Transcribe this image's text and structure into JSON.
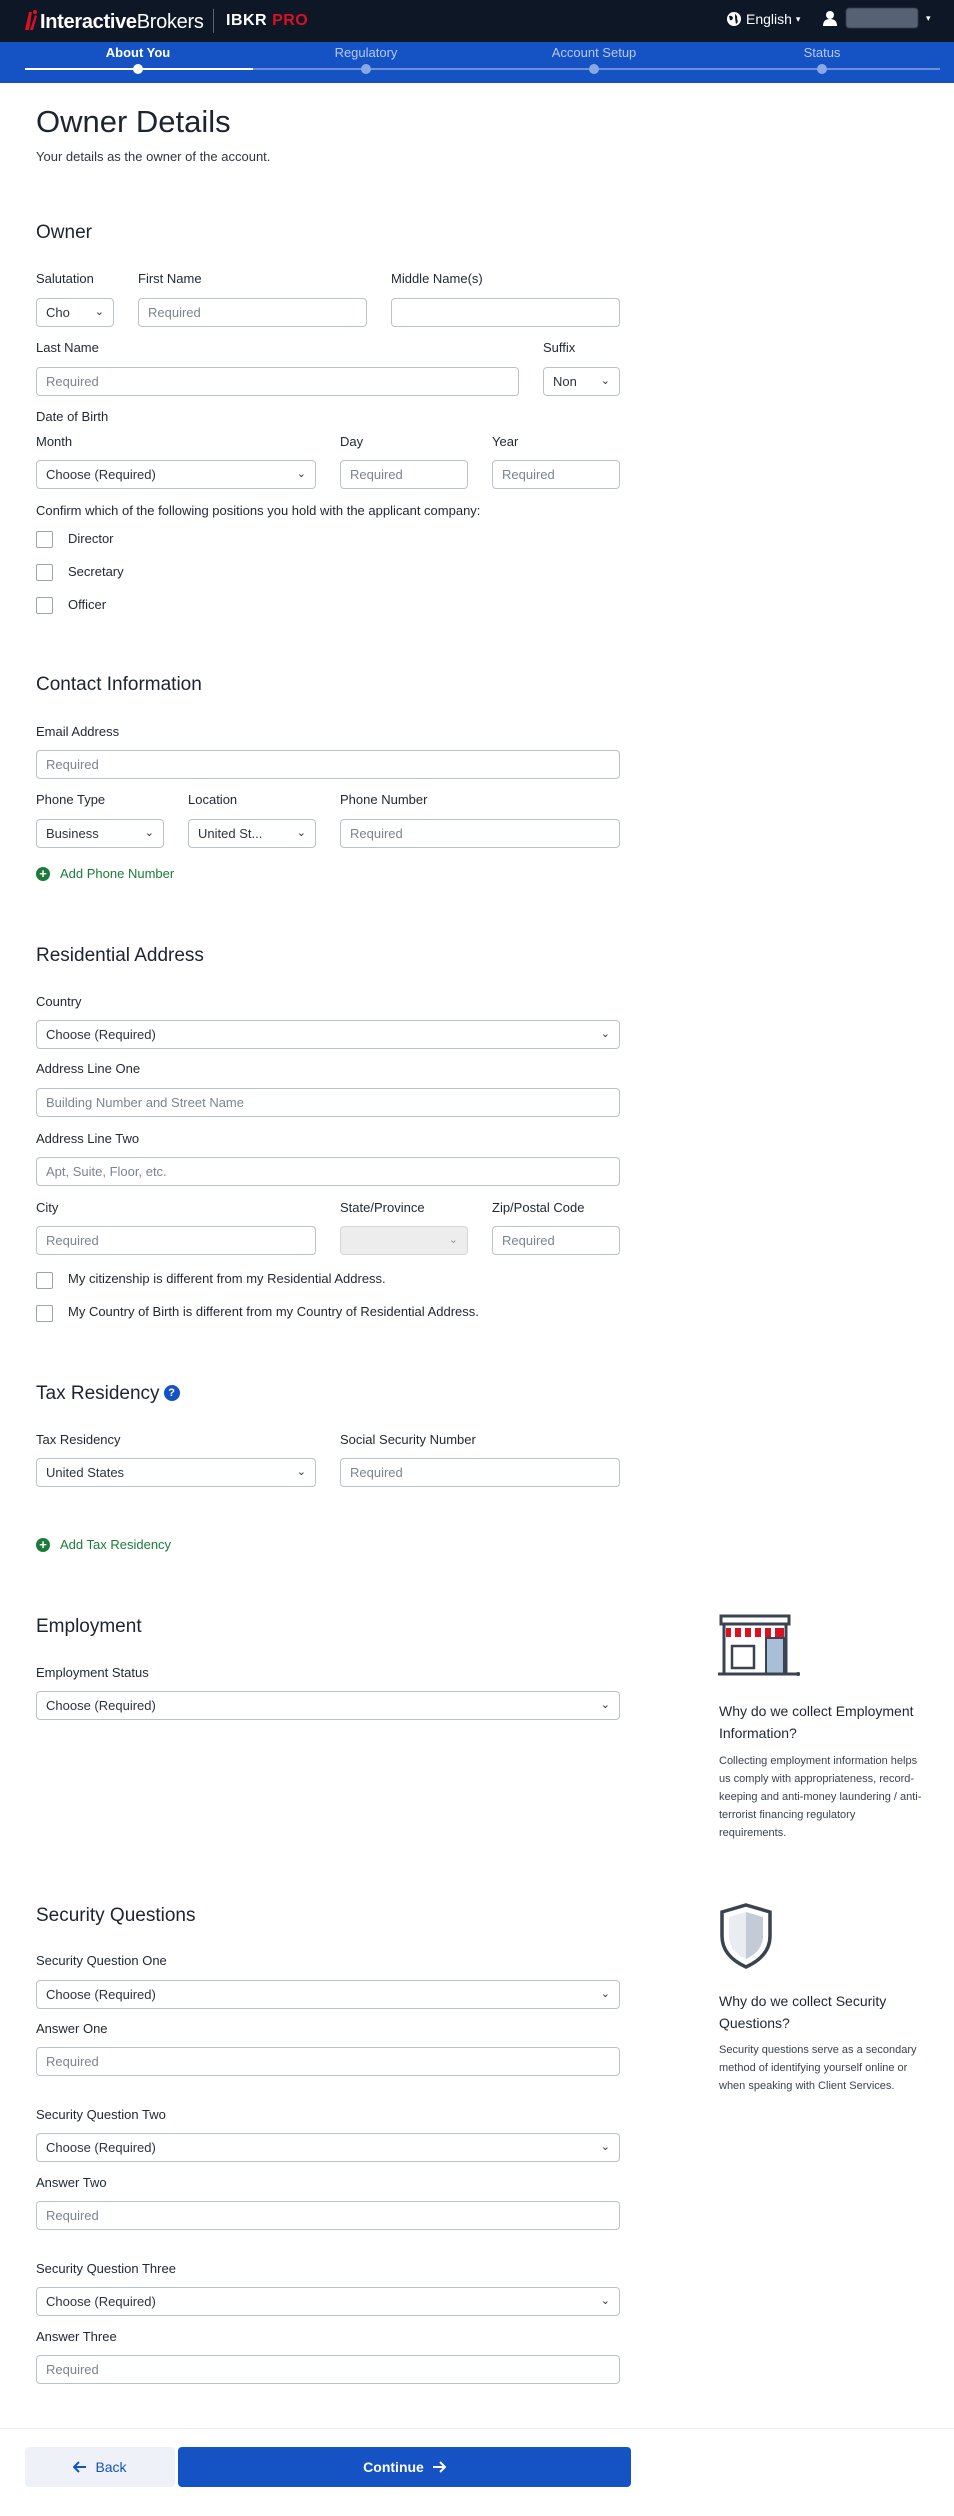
{
  "header": {
    "logo_bold": "Interactive",
    "logo_regular": "Brokers",
    "product": "IBKR",
    "product_suffix": "PRO",
    "language": "English",
    "caret": "▾",
    "brand_color": "#d81222"
  },
  "stepper": {
    "steps": [
      {
        "label": "About You"
      },
      {
        "label": "Regulatory"
      },
      {
        "label": "Account Setup"
      },
      {
        "label": "Status"
      }
    ],
    "active_index": 0
  },
  "page": {
    "title": "Owner Details",
    "subtitle": "Your details as the owner of the account."
  },
  "owner": {
    "heading": "Owner",
    "salutation_label": "Salutation",
    "salutation_value": "Cho",
    "first_name_label": "First Name",
    "first_name_placeholder": "Required",
    "middle_name_label": "Middle Name(s)",
    "last_name_label": "Last Name",
    "last_name_placeholder": "Required",
    "suffix_label": "Suffix",
    "suffix_value": "Non",
    "dob_label": "Date of Birth",
    "month_label": "Month",
    "month_value": "Choose (Required)",
    "day_label": "Day",
    "day_placeholder": "Required",
    "year_label": "Year",
    "year_placeholder": "Required",
    "positions_prompt": "Confirm which of the following positions you hold with the applicant company:",
    "positions": [
      "Director",
      "Secretary",
      "Officer"
    ]
  },
  "contact": {
    "heading": "Contact Information",
    "email_label": "Email Address",
    "email_placeholder": "Required",
    "phone_type_label": "Phone Type",
    "phone_type_value": "Business",
    "location_label": "Location",
    "location_value": "United St...",
    "phone_number_label": "Phone Number",
    "phone_number_placeholder": "Required",
    "add_phone": "Add Phone Number"
  },
  "address": {
    "heading": "Residential Address",
    "country_label": "Country",
    "country_value": "Choose (Required)",
    "line1_label": "Address Line One",
    "line1_placeholder": "Building Number and Street Name",
    "line2_label": "Address Line Two",
    "line2_placeholder": "Apt, Suite, Floor, etc.",
    "city_label": "City",
    "city_placeholder": "Required",
    "state_label": "State/Province",
    "zip_label": "Zip/Postal Code",
    "zip_placeholder": "Required",
    "citizenship_diff": "My citizenship is different from my Residential Address.",
    "birth_diff": "My Country of Birth is different from my Country of Residential Address."
  },
  "tax": {
    "heading": "Tax Residency",
    "help": "?",
    "residency_label": "Tax Residency",
    "residency_value": "United States",
    "ssn_label": "Social Security Number",
    "ssn_placeholder": "Required",
    "add_tax": "Add Tax Residency"
  },
  "employment": {
    "heading": "Employment",
    "status_label": "Employment Status",
    "status_value": "Choose (Required)",
    "side_title": "Why do we collect Employment Information?",
    "side_body": "Collecting employment information helps us comply with appropriateness, record-keeping and anti-money laundering / anti-terrorist financing regulatory requirements."
  },
  "security": {
    "heading": "Security Questions",
    "q1_label": "Security Question One",
    "q1_value": "Choose (Required)",
    "a1_label": "Answer One",
    "a1_placeholder": "Required",
    "q2_label": "Security Question Two",
    "q2_value": "Choose (Required)",
    "a2_label": "Answer Two",
    "a2_placeholder": "Required",
    "q3_label": "Security Question Three",
    "q3_value": "Choose (Required)",
    "a3_label": "Answer Three",
    "a3_placeholder": "Required",
    "side_title": "Why do we collect Security Questions?",
    "side_body": "Security questions serve as a secondary method of identifying yourself online or when speaking with Client Services."
  },
  "footer": {
    "back_label": "Back",
    "continue_label": "Continue"
  }
}
